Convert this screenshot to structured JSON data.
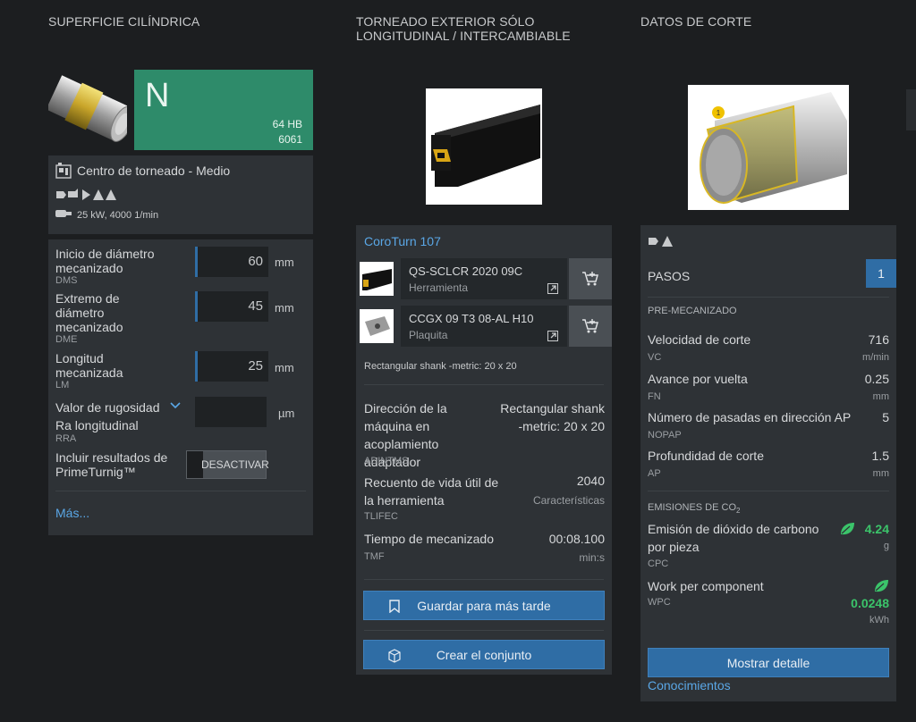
{
  "headers": {
    "col1": "SUPERFICIE CILÍNDRICA",
    "col2_line1": "TORNEADO EXTERIOR SÓLO",
    "col2_line2": "LONGITUDINAL / INTERCAMBIABLE",
    "col3": "DATOS DE CORTE"
  },
  "material": {
    "letter": "N",
    "hardness": "64 HB",
    "grade": "6061",
    "color": "#2e8b6a"
  },
  "machine": {
    "title": "Centro de torneado - Medio",
    "power": "25 kW, 4000 1/min"
  },
  "inputs": [
    {
      "label": "Inicio de diámetro mecanizado",
      "code": "DMS",
      "value": "60",
      "unit": "mm"
    },
    {
      "label": "Extremo de diámetro mecanizado",
      "code": "DME",
      "value": "45",
      "unit": "mm"
    },
    {
      "label": "Longitud mecanizada",
      "code": "LM",
      "value": "25",
      "unit": "mm"
    }
  ],
  "roughness": {
    "label": "Valor de rugosidad Ra longitudinal",
    "code": "RRA",
    "value": "",
    "unit": "µm"
  },
  "primeturn": {
    "label": "Incluir resultados de PrimeTurnig™",
    "toggle_label": "DESACTIVAR"
  },
  "more_link": "Más...",
  "tool": {
    "family": "CoroTurn 107",
    "items": [
      {
        "name": "QS-SCLCR 2020 09C",
        "type": "Herramienta"
      },
      {
        "name": "CCGX 09 T3 08-AL H10",
        "type": "Plaquita"
      }
    ],
    "shank_note": "Rectangular shank -metric: 20 x 20",
    "details": [
      {
        "label": "Dirección de la máquina en acoplamiento adaptador",
        "code": "ADINTMS",
        "value": "Rectangular shank -metric: 20 x 20",
        "unit": ""
      },
      {
        "label": "Recuento de vida útil de la herramienta",
        "code": "TLIFEC",
        "value": "2040",
        "unit": "Características"
      },
      {
        "label": "Tiempo de mecanizado",
        "code": "TMF",
        "value": "00:08.100",
        "unit": "min:s"
      }
    ],
    "save_label": "Guardar para más tarde",
    "assembly_label": "Crear el conjunto"
  },
  "cutting": {
    "steps_label": "PASOS",
    "steps_value": "1",
    "premach_label": "PRE-MECANIZADO",
    "params": [
      {
        "label": "Velocidad de corte",
        "code": "VC",
        "value": "716",
        "unit": "m/min"
      },
      {
        "label": "Avance por vuelta",
        "code": "FN",
        "value": "0.25",
        "unit": "mm"
      },
      {
        "label": "Número de pasadas en dirección AP",
        "code": "NOPAP",
        "value": "5",
        "unit": ""
      },
      {
        "label": "Profundidad de corte",
        "code": "AP",
        "value": "1.5",
        "unit": "mm"
      }
    ],
    "emissions_label": "EMISIONES DE CO",
    "emissions_sub": "2",
    "co2": {
      "label": "Emisión de dióxido de carbono por pieza",
      "code": "CPC",
      "value": "4.24",
      "unit": "g"
    },
    "work": {
      "label": "Work per component",
      "code": "WPC",
      "value": "0.0248",
      "unit": "kWh"
    },
    "green": "#3bc46a",
    "detail_button": "Mostrar detalle",
    "knowledge_link": "Conocimientos"
  }
}
